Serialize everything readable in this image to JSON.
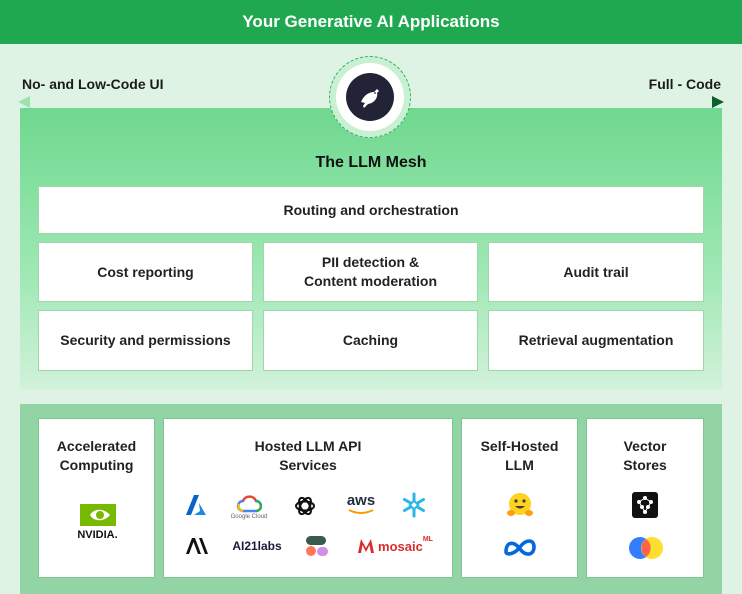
{
  "banner": {
    "title": "Your Generative AI Applications"
  },
  "axis": {
    "left_label": "No- and Low-Code UI",
    "right_label": "Full - Code"
  },
  "mesh": {
    "title": "The LLM Mesh",
    "routing": "Routing and orchestration",
    "cost": "Cost reporting",
    "pii_line1": "PII detection &",
    "pii_line2": "Content moderation",
    "audit": "Audit trail",
    "security": "Security and permissions",
    "caching": "Caching",
    "retrieval": "Retrieval augmentation"
  },
  "infra": {
    "accelerated": {
      "line1": "Accelerated",
      "line2": "Computing",
      "logo_text": "NVIDIA."
    },
    "hosted": {
      "line1": "Hosted LLM API",
      "line2": "Services",
      "google_cloud": "Google Cloud",
      "aws": "aws",
      "ai21": "AI21labs",
      "mosaic": "mosaic",
      "mosaic_sup": "ML"
    },
    "selfhosted": {
      "line1": "Self-Hosted",
      "line2": "LLM"
    },
    "vector": {
      "line1": "Vector",
      "line2": "Stores"
    }
  },
  "colors": {
    "brand_green": "#1fa84f",
    "mesh_green": "#6fd88f",
    "dark": "#1e1e2e"
  }
}
